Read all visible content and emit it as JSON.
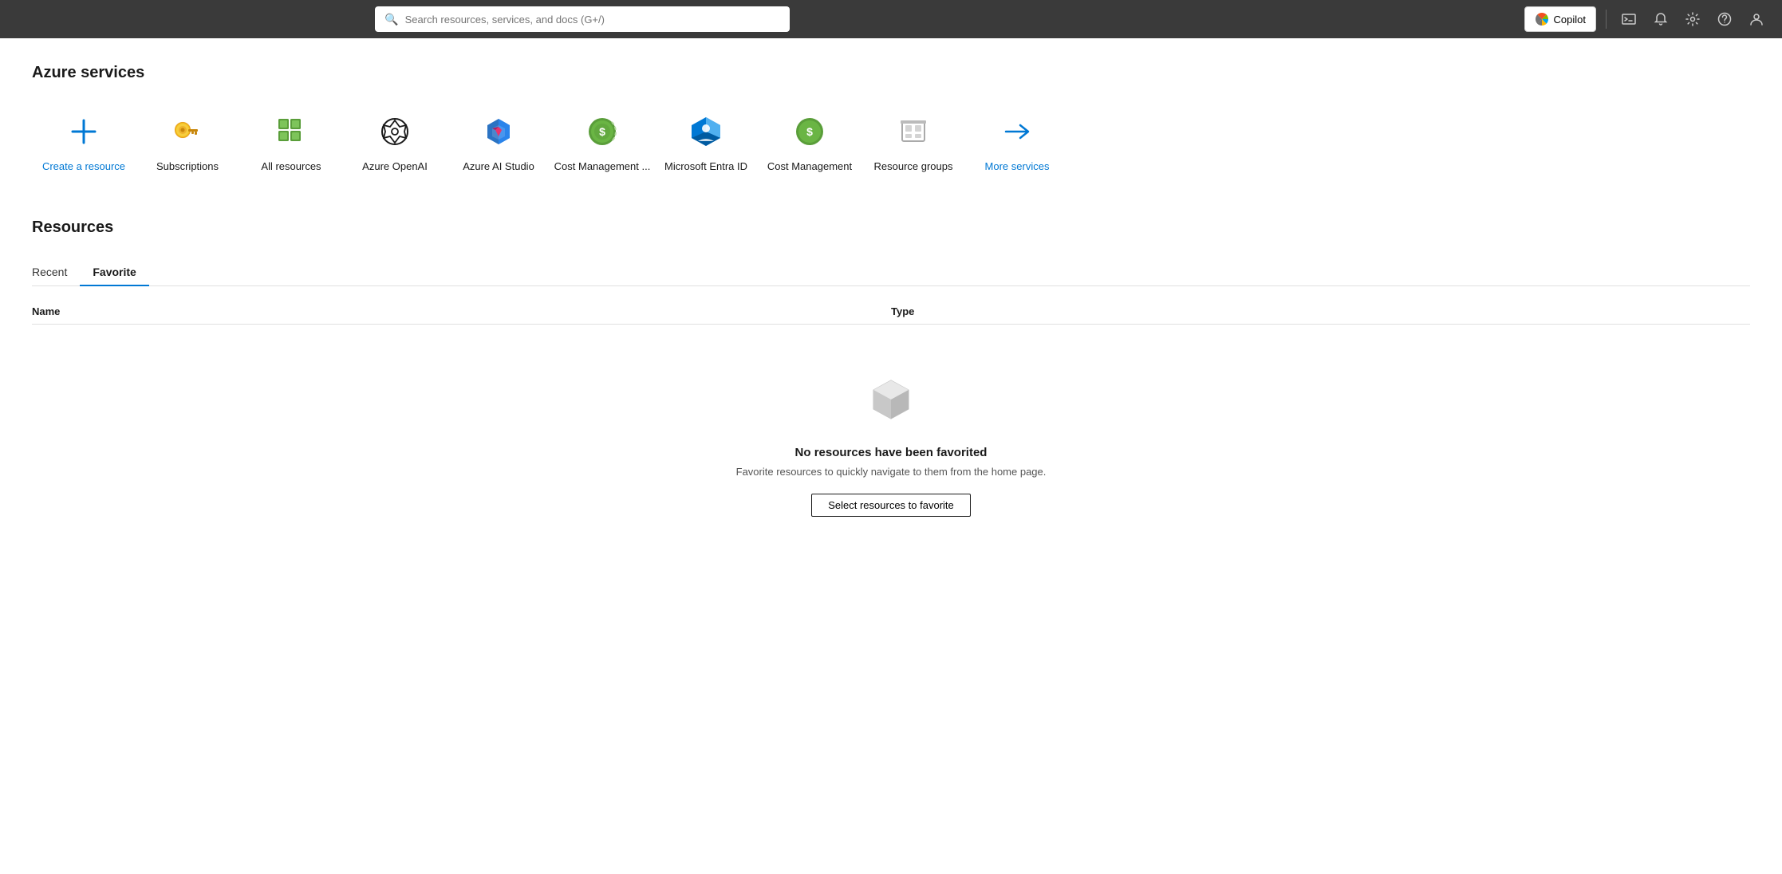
{
  "topbar": {
    "search_placeholder": "Search resources, services, and docs (G+/)",
    "copilot_label": "Copilot",
    "icons": {
      "terminal": "▣",
      "bell": "🔔",
      "gear": "⚙",
      "help": "?",
      "user": "👤"
    }
  },
  "azure_services": {
    "section_title": "Azure services",
    "items": [
      {
        "id": "create-resource",
        "label": "Create a resource",
        "icon_type": "plus",
        "blue_label": true
      },
      {
        "id": "subscriptions",
        "label": "Subscriptions",
        "icon_type": "key",
        "blue_label": false
      },
      {
        "id": "all-resources",
        "label": "All resources",
        "icon_type": "grid",
        "blue_label": false
      },
      {
        "id": "azure-openai",
        "label": "Azure OpenAI",
        "icon_type": "openai",
        "blue_label": false
      },
      {
        "id": "azure-ai-studio",
        "label": "Azure AI Studio",
        "icon_type": "ai-studio",
        "blue_label": false
      },
      {
        "id": "cost-management-1",
        "label": "Cost Management ...",
        "icon_type": "cost-green",
        "blue_label": false
      },
      {
        "id": "microsoft-entra",
        "label": "Microsoft Entra ID",
        "icon_type": "entra",
        "blue_label": false
      },
      {
        "id": "cost-management-2",
        "label": "Cost Management",
        "icon_type": "cost-management",
        "blue_label": false
      },
      {
        "id": "resource-groups",
        "label": "Resource groups",
        "icon_type": "resource-groups",
        "blue_label": false
      },
      {
        "id": "more-services",
        "label": "More services",
        "icon_type": "arrow",
        "blue_label": true
      }
    ]
  },
  "resources": {
    "section_title": "Resources",
    "tabs": [
      {
        "id": "recent",
        "label": "Recent",
        "active": false
      },
      {
        "id": "favorite",
        "label": "Favorite",
        "active": true
      }
    ],
    "columns": {
      "name": "Name",
      "type": "Type"
    },
    "empty_state": {
      "title": "No resources have been favorited",
      "subtitle": "Favorite resources to quickly navigate to them from the home page.",
      "button_label": "Select resources to favorite"
    }
  }
}
